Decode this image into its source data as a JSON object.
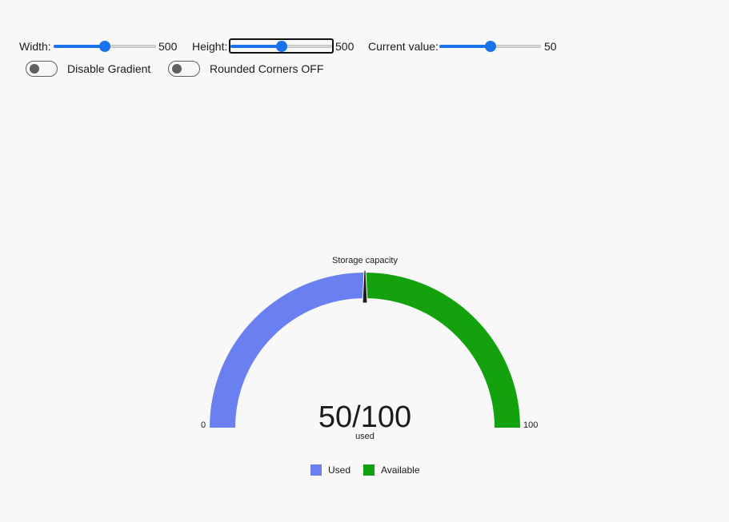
{
  "controls": {
    "width_label": "Width:",
    "width_value": "500",
    "width_level": 0.5,
    "height_label": "Height:",
    "height_value": "500",
    "height_level": 0.5,
    "current_label": "Current value:",
    "current_value": "50",
    "current_level": 0.5,
    "toggle_gradient_label": "Disable Gradient",
    "toggle_gradient_on": false,
    "toggle_rounded_label": "Rounded Corners OFF",
    "toggle_rounded_on": false,
    "accent_color": "#1a73e8"
  },
  "chart_data": {
    "type": "gauge",
    "title": "Storage capacity",
    "min": 0,
    "max": 100,
    "value": 50,
    "min_label": "0",
    "max_label": "100",
    "center_value_text": "50/100",
    "center_sub_text": "used",
    "segments": [
      {
        "name": "Used",
        "value": 50,
        "color": "#6a7ff0"
      },
      {
        "name": "Available",
        "value": 50,
        "color": "#13a10e"
      }
    ],
    "legend": [
      "Used",
      "Available"
    ],
    "needle_color": "#1b1b1b"
  }
}
